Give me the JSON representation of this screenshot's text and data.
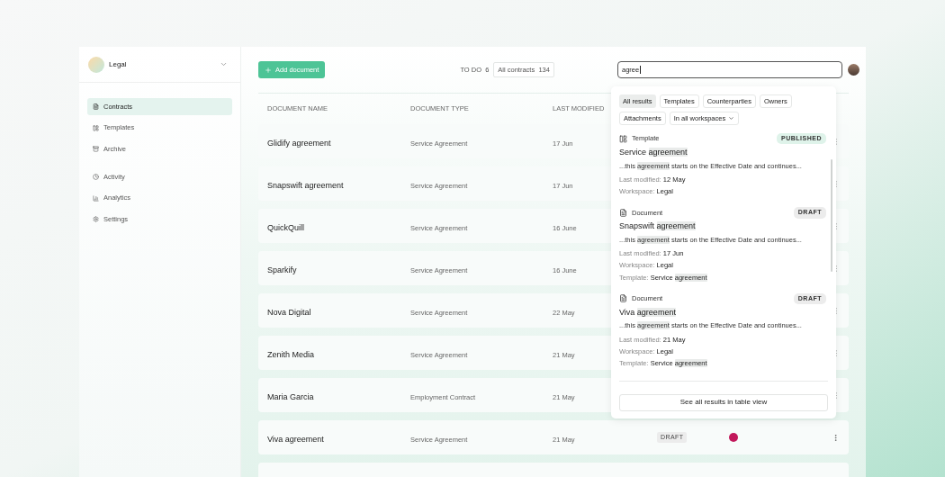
{
  "workspace": {
    "name": "Legal"
  },
  "nav_groups": [
    [
      {
        "label": "Contracts",
        "selected": true
      },
      {
        "label": "Templates",
        "selected": false
      },
      {
        "label": "Archive",
        "selected": false
      }
    ],
    [
      {
        "label": "Activity",
        "selected": false
      },
      {
        "label": "Analytics",
        "selected": false
      },
      {
        "label": "Settings",
        "selected": false
      }
    ]
  ],
  "toolbar": {
    "add_button": "Add document",
    "todo": {
      "label": "TO DO",
      "count": "6"
    },
    "all_contracts": {
      "label": "All contracts",
      "count": "134"
    }
  },
  "search": {
    "value": "agree"
  },
  "table": {
    "columns": [
      "DOCUMENT NAME",
      "DOCUMENT TYPE",
      "LAST MODIFIED"
    ],
    "rows": [
      {
        "name": "Glidify agreement",
        "type": "Service Agreement",
        "modified": "17 Jun"
      },
      {
        "name": "Snapswift agreement",
        "type": "Service Agreement",
        "modified": "17 Jun"
      },
      {
        "name": "QuickQuill",
        "type": "Service Agreement",
        "modified": "16 June"
      },
      {
        "name": "Sparkify",
        "type": "Service Agreement",
        "modified": "16 June"
      },
      {
        "name": "Nova Digital",
        "type": "Service Agreement",
        "modified": "22 May"
      },
      {
        "name": "Zenith Media",
        "type": "Service Agreement",
        "modified": "21 May"
      },
      {
        "name": "Maria Garcia",
        "type": "Employment Contract",
        "modified": "21 May"
      },
      {
        "name": "Viva agreement",
        "type": "Service Agreement",
        "modified": "21 May",
        "status": "DRAFT",
        "owner": {
          "color": "#c2185b"
        }
      }
    ]
  },
  "search_results": {
    "filters": [
      {
        "label": "All results",
        "selected": true
      },
      {
        "label": "Templates",
        "selected": false
      },
      {
        "label": "Counterparties",
        "selected": false
      },
      {
        "label": "Owners",
        "selected": false
      },
      {
        "label": "Attachments",
        "selected": false
      }
    ],
    "workspace_filter": "In all workspaces",
    "results": [
      {
        "kind": "template",
        "type_label": "Template",
        "status": "PUBLISHED",
        "color": "#dff3ea",
        "title": [
          {
            "text": "Service ",
            "highlight": false
          },
          {
            "text": "agreement",
            "highlight": true
          }
        ],
        "excerpt": [
          {
            "text": "...this ",
            "highlight": false
          },
          {
            "text": "agreement",
            "highlight": true
          },
          {
            "text": " starts on the Effective Date and continues...",
            "highlight": false
          }
        ],
        "meta": [
          {
            "label": "Last modified:",
            "parts": [
              {
                "text": "12 May",
                "highlight": false
              }
            ]
          },
          {
            "label": "Workspace:",
            "parts": [
              {
                "text": "Legal",
                "highlight": false
              }
            ]
          }
        ]
      },
      {
        "kind": "document",
        "type_label": "Document",
        "status": "DRAFT",
        "color": "#ececec",
        "title": [
          {
            "text": "Snapswift ",
            "highlight": false
          },
          {
            "text": "agreement",
            "highlight": true
          }
        ],
        "excerpt": [
          {
            "text": "...this ",
            "highlight": false
          },
          {
            "text": "agreement",
            "highlight": true
          },
          {
            "text": " starts on the Effective Date and continues...",
            "highlight": false
          }
        ],
        "meta": [
          {
            "label": "Last modified:",
            "parts": [
              {
                "text": "17 Jun",
                "highlight": false
              }
            ]
          },
          {
            "label": "Workspace:",
            "parts": [
              {
                "text": "Legal",
                "highlight": false
              }
            ]
          },
          {
            "label": "Template:",
            "parts": [
              {
                "text": "Service ",
                "highlight": false
              },
              {
                "text": "agreement",
                "highlight": true
              }
            ]
          }
        ]
      },
      {
        "kind": "document",
        "type_label": "Document",
        "status": "DRAFT",
        "color": "#ececec",
        "title": [
          {
            "text": "Viva ",
            "highlight": false
          },
          {
            "text": "agreement",
            "highlight": true
          }
        ],
        "excerpt": [
          {
            "text": "...this ",
            "highlight": false
          },
          {
            "text": "agreement",
            "highlight": true
          },
          {
            "text": " starts on the Effective Date and continues...",
            "highlight": false
          }
        ],
        "meta": [
          {
            "label": "Last modified:",
            "parts": [
              {
                "text": "21 May",
                "highlight": false
              }
            ]
          },
          {
            "label": "Workspace:",
            "parts": [
              {
                "text": "Legal",
                "highlight": false
              }
            ]
          },
          {
            "label": "Template:",
            "parts": [
              {
                "text": "Service ",
                "highlight": false
              },
              {
                "text": "agreement",
                "highlight": true
              }
            ]
          }
        ]
      }
    ],
    "see_all_button": "See all results in table view"
  }
}
